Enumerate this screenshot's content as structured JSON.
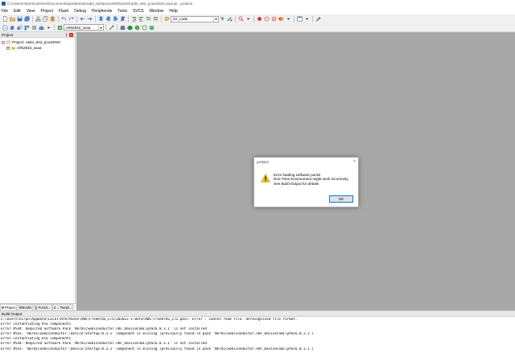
{
  "window": {
    "title": "C:\\Users\\nirpo\\OneDrive\\Documents\\peripheral\\radio_test\\pca10040\\arm5\\radio_test_pca10040.uvprojx - µVision"
  },
  "menu": [
    "File",
    "Edit",
    "View",
    "Project",
    "Flash",
    "Debug",
    "Peripherals",
    "Tools",
    "SVCS",
    "Window",
    "Help"
  ],
  "toolbar": {
    "find_value": "err_code",
    "target_value": "nrf52832_xxaa"
  },
  "project_panel": {
    "header": "Project",
    "pin": "‡",
    "close": "×",
    "tree": [
      {
        "label": "Project: radio_test_pca10040",
        "expander": "−"
      },
      {
        "label": "nrf52832_xxaa",
        "expander": "+"
      }
    ],
    "tabs": [
      "Project",
      "Books",
      "{} Functi...",
      "0→ Templ..."
    ]
  },
  "build_output": {
    "header": "Build Output",
    "lines": [
      "C:\\Users\\nirpo\\AppData\\Local\\Arm\\Packs\\AWS\\FreeRTOS_LTS\\202012.1-Beta\\AWS.FreeRTOS_LTS.pdsc: Error : cannot read file. Unrecognized file format.",
      "Error instantiating RTE components",
      "Error #544: Required Software Pack 'NordicSemiconductor.nRF_DeviceFamilyPack.8.3.1' is not installed",
      "Error #541: 'NordicSemiconductor::Device:Startup:8.3.1' component is missing (previously found in pack 'NordicSemiconductor.nRF_DeviceFamilyPack.8.3.1')",
      "Error instantiating RTE components",
      "Error #544: Required Software Pack 'NordicSemiconductor.nRF_DeviceFamilyPack.8.3.1' is not installed",
      "Error #541: 'NordicSemiconductor::Device:Startup:8.3.1' component is missing (previously found in pack 'NordicSemiconductor.nRF_DeviceFamilyPack.8.3.1')"
    ]
  },
  "dialog": {
    "title": "µVision",
    "close": "×",
    "lines": [
      "Error loading software packs",
      "Run-Time Environment might work incorrectly.",
      "See Build Output for details"
    ],
    "ok_label": "OK"
  },
  "colors": {
    "editor_bg": "#a8a8a8",
    "close_red": "#d8302f",
    "warning_yellow": "#f5c518",
    "dialog_focus": "#0078d7"
  }
}
